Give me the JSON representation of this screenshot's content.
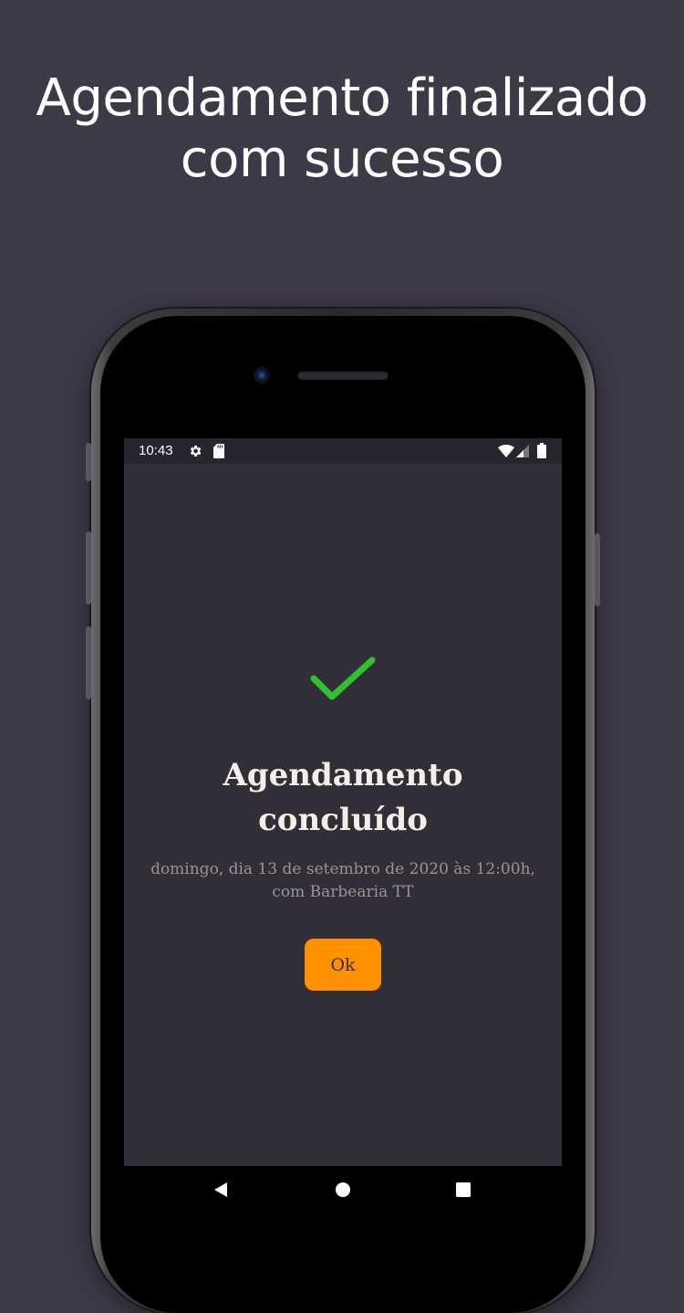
{
  "headline": {
    "line1": "Agendamento finalizado",
    "line2": "com sucesso"
  },
  "status_bar": {
    "time": "10:43",
    "icons": [
      "settings-icon",
      "sd-card-icon",
      "wifi-icon",
      "signal-icon",
      "battery-icon"
    ]
  },
  "confirmation": {
    "icon": "check-icon",
    "title_line1": "Agendamento",
    "title_line2": "concluído",
    "details_line1": "domingo, dia 13 de setembro de 2020 às 12:00h,",
    "details_line2": "com Barbearia TT",
    "ok_label": "Ok"
  },
  "nav_bar": {
    "icons": [
      "back-icon",
      "home-icon",
      "recents-icon"
    ]
  },
  "colors": {
    "background": "#3e3947",
    "screen_background": "#312e38",
    "accent": "#ff9000",
    "success": "#2fc22f",
    "title_text": "#f4ede8",
    "secondary_text": "#999591"
  }
}
